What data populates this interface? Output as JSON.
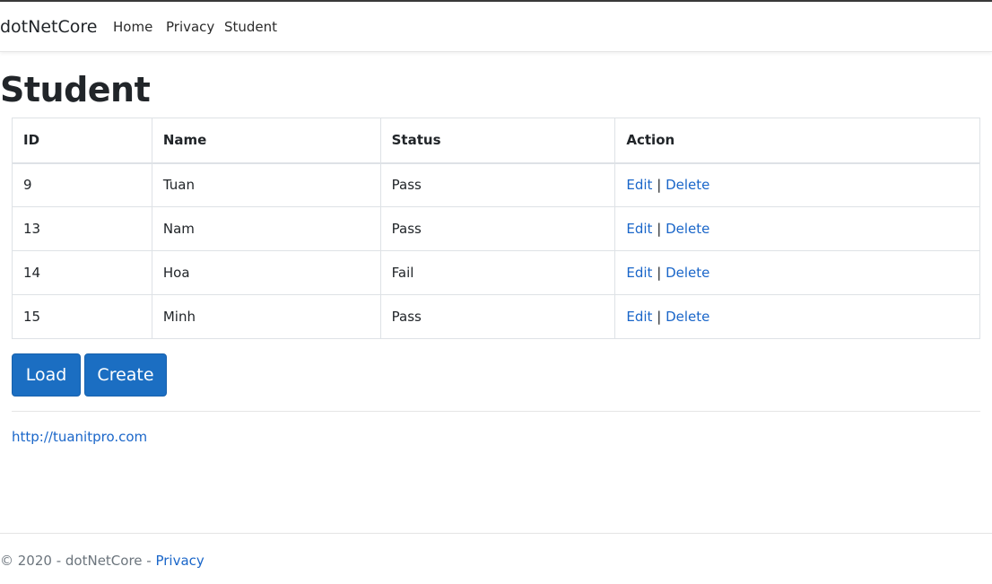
{
  "navbar": {
    "brand": "dotNetCore",
    "links": [
      "Home",
      "Privacy",
      "Student"
    ]
  },
  "page": {
    "title": "Student"
  },
  "table": {
    "headers": [
      "ID",
      "Name",
      "Status",
      "Action"
    ],
    "rows": [
      {
        "id": "9",
        "name": "Tuan",
        "status": "Pass",
        "edit": "Edit",
        "sep": "|",
        "delete": "Delete"
      },
      {
        "id": "13",
        "name": "Nam",
        "status": "Pass",
        "edit": "Edit",
        "sep": "|",
        "delete": "Delete"
      },
      {
        "id": "14",
        "name": "Hoa",
        "status": "Fail",
        "edit": "Edit",
        "sep": "|",
        "delete": "Delete"
      },
      {
        "id": "15",
        "name": "Minh",
        "status": "Pass",
        "edit": "Edit",
        "sep": "|",
        "delete": "Delete"
      }
    ]
  },
  "buttons": {
    "load": "Load",
    "create": "Create"
  },
  "site_link": "http://tuanitpro.com",
  "footer": {
    "copyright": "© 2020 - dotNetCore - ",
    "privacy": "Privacy"
  },
  "colors": {
    "link": "#1a66c9",
    "button": "#1b6ec2",
    "text": "#212529",
    "muted": "#6c757d"
  }
}
